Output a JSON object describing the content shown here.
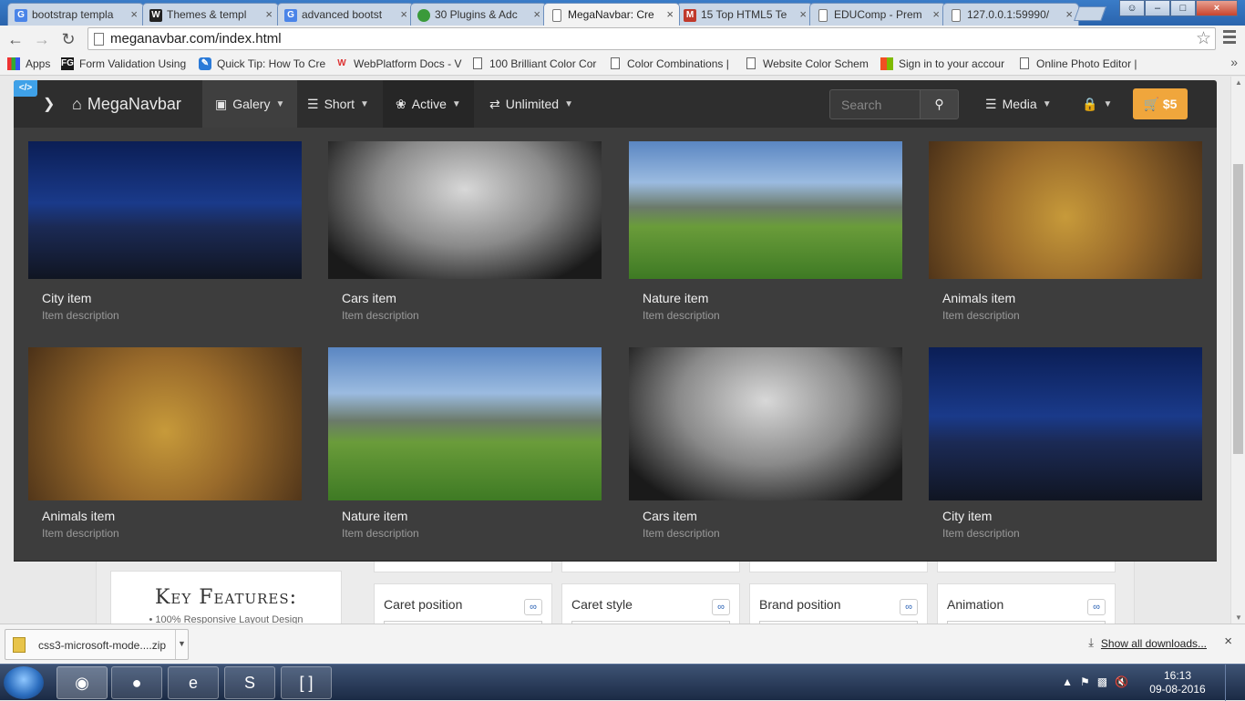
{
  "tabs": [
    {
      "title": "bootstrap templa",
      "icon": "G",
      "color": "#4a84e8"
    },
    {
      "title": "Themes & templ",
      "icon": "W",
      "color": "#222222"
    },
    {
      "title": "advanced bootst",
      "icon": "G",
      "color": "#4a84e8"
    },
    {
      "title": "30 Plugins & Adc",
      "icon": "leaf",
      "color": "#3a9a3a"
    },
    {
      "title": "MegaNavbar: Cre",
      "icon": "page",
      "color": "#ffffff"
    },
    {
      "title": "15 Top HTML5 Te",
      "icon": "M",
      "color": "#c0392b"
    },
    {
      "title": "EDUComp - Prem",
      "icon": "page",
      "color": "#ffffff"
    },
    {
      "title": "127.0.0.1:59990/",
      "icon": "page",
      "color": "#ffffff"
    }
  ],
  "url": "meganavbar.com/index.html",
  "bookmarks": [
    {
      "label": "Apps"
    },
    {
      "label": "Form Validation Using"
    },
    {
      "label": "Quick Tip: How To Cre"
    },
    {
      "label": "WebPlatform Docs - V"
    },
    {
      "label": "100 Brilliant Color Cor"
    },
    {
      "label": "Color Combinations |"
    },
    {
      "label": "Website Color Schem"
    },
    {
      "label": "Sign in to your accour"
    },
    {
      "label": "Online Photo Editor |"
    }
  ],
  "navbar": {
    "code_badge": "</>",
    "brand": "MegaNavbar",
    "galery": "Galery",
    "short": "Short",
    "active": "Active",
    "unlimited": "Unlimited",
    "search_placeholder": "Search",
    "media": "Media",
    "cart": "$5"
  },
  "gallery": [
    {
      "title": "City item",
      "desc": "Item description",
      "kind": "city"
    },
    {
      "title": "Cars item",
      "desc": "Item description",
      "kind": "car"
    },
    {
      "title": "Nature item",
      "desc": "Item description",
      "kind": "nature"
    },
    {
      "title": "Animals item",
      "desc": "Item description",
      "kind": "hawk"
    },
    {
      "title": "Animals item",
      "desc": "Item description",
      "kind": "hawk"
    },
    {
      "title": "Nature item",
      "desc": "Item description",
      "kind": "nature"
    },
    {
      "title": "Cars item",
      "desc": "Item description",
      "kind": "car"
    },
    {
      "title": "City item",
      "desc": "Item description",
      "kind": "city"
    }
  ],
  "features": {
    "title": "Key Features:",
    "item": "• 100% Responsive Layout Design"
  },
  "options": [
    {
      "label": "Caret position"
    },
    {
      "label": "Caret style"
    },
    {
      "label": "Brand position"
    },
    {
      "label": "Animation"
    }
  ],
  "download": {
    "filename": "css3-microsoft-mode....zip",
    "show_all": "Show all downloads..."
  },
  "clock": {
    "time": "16:13",
    "date": "09-08-2016"
  }
}
